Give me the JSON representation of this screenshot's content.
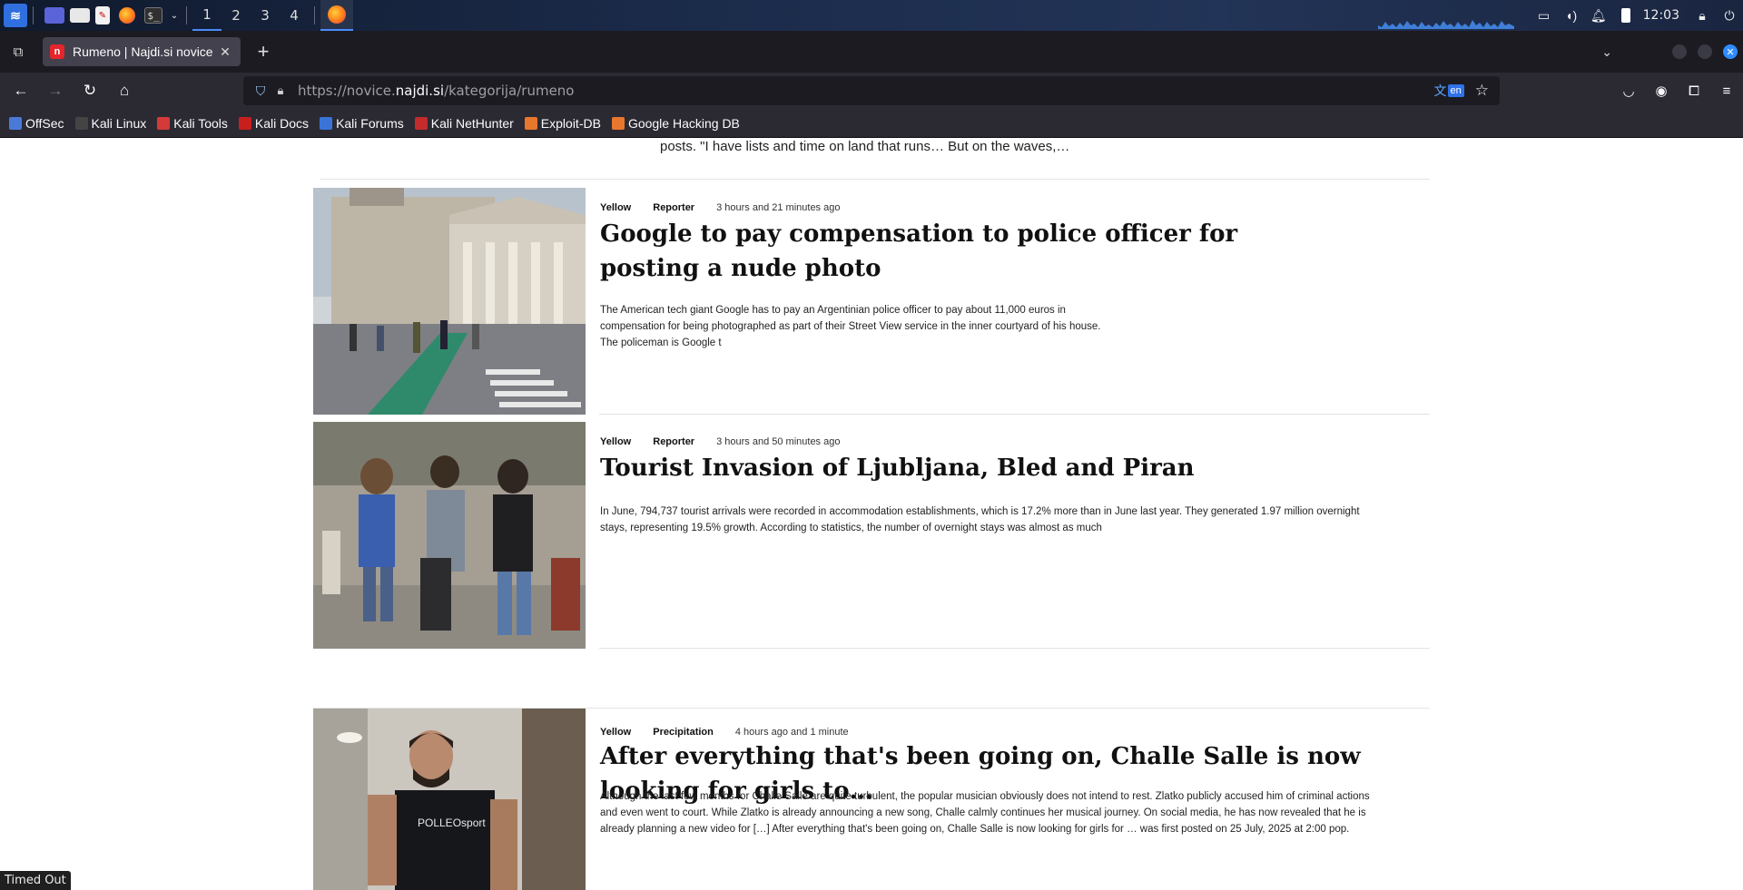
{
  "taskbar": {
    "workspaces": [
      "1",
      "2",
      "3",
      "4"
    ],
    "active_workspace": "1",
    "clock": "12:03"
  },
  "browser": {
    "tab": {
      "title": "Rumeno | Najdi.si novice",
      "favicon_letter": "n"
    },
    "url": {
      "prefix": "https://novice.",
      "domain": "najdi.si",
      "path": "/kategorija/rumeno"
    },
    "translate_lang": "en",
    "bookmarks": [
      {
        "label": "OffSec",
        "color": "#4b79d8"
      },
      {
        "label": "Kali Linux",
        "color": "#444444"
      },
      {
        "label": "Kali Tools",
        "color": "#d43a3a"
      },
      {
        "label": "Kali Docs",
        "color": "#c81e1e"
      },
      {
        "label": "Kali Forums",
        "color": "#3a74d8"
      },
      {
        "label": "Kali NetHunter",
        "color": "#c42b2b"
      },
      {
        "label": "Exploit-DB",
        "color": "#e8772e"
      },
      {
        "label": "Google Hacking DB",
        "color": "#e8772e"
      }
    ]
  },
  "page": {
    "previous_tail": "posts. \"I have lists and time on land that runs… But on the waves,…",
    "articles": [
      {
        "category": "Yellow",
        "source": "Reporter",
        "time": "3 hours and 21 minutes ago",
        "headline_lines": [
          "Google to pay compensation to police officer for",
          "posting a nude photo"
        ],
        "excerpt_lines": [
          "The American tech giant Google has to pay an Argentinian police officer to pay about 11,000 euros in",
          "compensation for being photographed as part of their Street View service in the inner courtyard of his house.",
          "The policeman is Google t"
        ]
      },
      {
        "category": "Yellow",
        "source": "Reporter",
        "time": "3 hours and 50 minutes ago",
        "headline_lines": [
          "Tourist Invasion of Ljubljana, Bled and Piran"
        ],
        "excerpt_lines": [
          "In June, 794,737 tourist arrivals were recorded in accommodation establishments, which is 17.2% more than in June last year. They generated 1.97 million overnight",
          "stays, representing 19.5% growth. According to statistics, the number of overnight stays was almost as much"
        ]
      },
      {
        "category": "Yellow",
        "source": "Precipitation",
        "time": "4 hours ago and 1 minute",
        "headline_lines": [
          "After everything that's been going on, Challe Salle is now looking for girls to…"
        ],
        "excerpt_lines": [
          "Although the last few months for Challe Salle are quite turbulent, the popular musician obviously does not intend to rest. Zlatko publicly accused him of criminal actions",
          "and even went to court. While Zlatko is already announcing a new song, Challe calmly continues her musical journey. On social media, he has now revealed that he is",
          "already planning a new video for […] After everything that's been going on, Challe Salle is now looking for girls for … was first posted on 25 July, 2025 at 2:00 pop."
        ],
        "image_text": "POLLEOsport"
      }
    ],
    "status_text": "Timed Out"
  }
}
